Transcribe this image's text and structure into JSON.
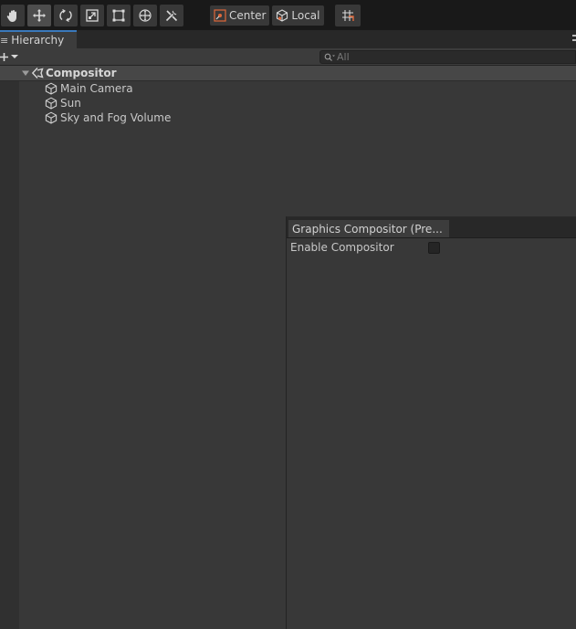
{
  "toolbar": {
    "tools": [
      {
        "name": "hand-tool",
        "icon": "hand-icon"
      },
      {
        "name": "move-tool",
        "icon": "move-arrows-icon",
        "active": true
      },
      {
        "name": "rotate-tool",
        "icon": "rotate-icon"
      },
      {
        "name": "scale-tool",
        "icon": "scale-icon"
      },
      {
        "name": "rect-tool",
        "icon": "rect-transform-icon"
      },
      {
        "name": "transform-tool",
        "icon": "transform-icon"
      },
      {
        "name": "custom-tool",
        "icon": "tools-icon"
      }
    ],
    "pivot_mode_label": "Center",
    "pivot_rotation_label": "Local",
    "snap_icon": "grid-snap-icon"
  },
  "hierarchy": {
    "tab_label": "Hierarchy",
    "menu_glyph": "≡",
    "search_placeholder": "All",
    "scene_name": "Compositor",
    "items": [
      {
        "label": "Main Camera"
      },
      {
        "label": "Sun"
      },
      {
        "label": "Sky and Fog Volume"
      }
    ]
  },
  "inspector": {
    "tab_label": "Graphics Compositor (Pre...",
    "properties": [
      {
        "label": "Enable Compositor",
        "checked": false
      }
    ]
  },
  "colors": {
    "accent_tab": "#3a79bb",
    "panel_bg": "#383838",
    "topbar_bg": "#191919"
  }
}
